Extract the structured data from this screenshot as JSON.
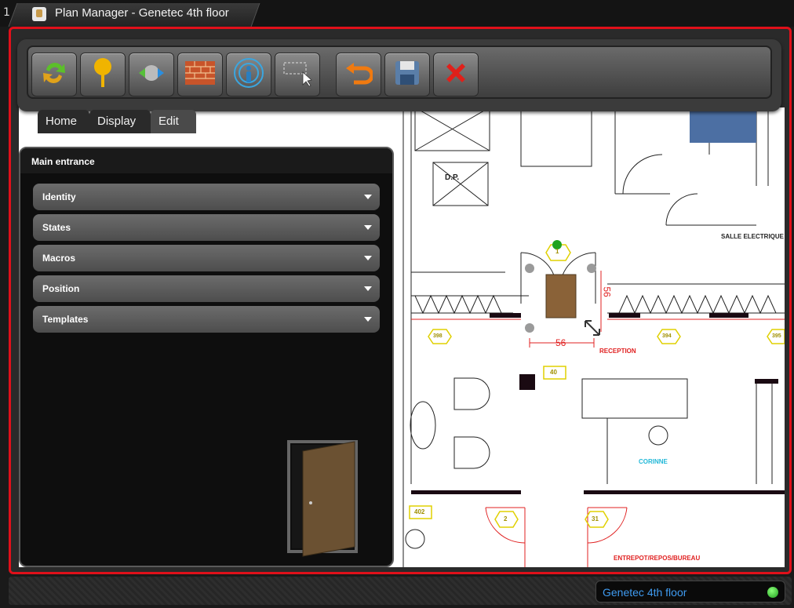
{
  "window": {
    "tab_number": "1",
    "title": "Plan Manager - Genetec 4th floor"
  },
  "toolbar": {
    "buttons": [
      {
        "name": "refresh-map-button",
        "icon": "refresh-arrows-icon"
      },
      {
        "name": "add-pin-button",
        "icon": "pin-icon"
      },
      {
        "name": "add-door-button",
        "icon": "door-swap-icon"
      },
      {
        "name": "add-wall-button",
        "icon": "brick-wall-icon"
      },
      {
        "name": "add-intercom-button",
        "icon": "signal-person-icon"
      },
      {
        "name": "select-area-button",
        "icon": "select-area-icon"
      },
      {
        "name": "undo-button",
        "icon": "undo-icon"
      },
      {
        "name": "save-button",
        "icon": "save-icon"
      },
      {
        "name": "delete-button",
        "icon": "close-x-icon"
      }
    ]
  },
  "subtabs": [
    {
      "label": "Home"
    },
    {
      "label": "Display"
    },
    {
      "label": "Edit"
    }
  ],
  "panel": {
    "title": "Main entrance",
    "sections": [
      {
        "label": "Identity"
      },
      {
        "label": "States"
      },
      {
        "label": "Macros"
      },
      {
        "label": "Position"
      },
      {
        "label": "Templates"
      }
    ]
  },
  "floorplan": {
    "labels": {
      "dp": "D.P.",
      "salle_electrique": "SALLE ELECTRIQUE",
      "reception": "RECEPTION",
      "corinne": "CORINNE",
      "entrepot": "ENTREPOT/REPOS/BUREAU",
      "dimension_h": "56",
      "dimension_v": "56",
      "door_1": "1",
      "door_2": "2",
      "door_31": "31",
      "room_398": "398",
      "room_394": "394",
      "room_395": "395",
      "tag_40": "40",
      "tag_402": "402"
    }
  },
  "status_bar": {
    "map_name": "Genetec 4th floor"
  },
  "colors": {
    "frame_border": "#e0101a",
    "status_text": "#3f9bf0",
    "indicator": "#1d9e1d"
  }
}
